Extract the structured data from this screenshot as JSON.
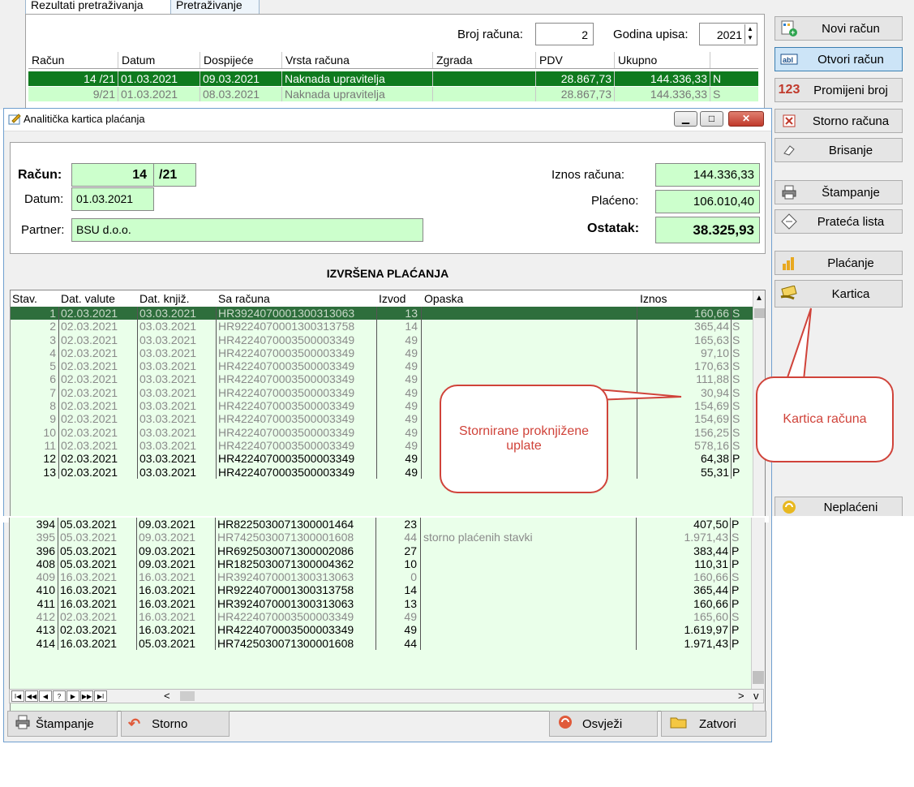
{
  "bg": {
    "tabs": [
      "Rezultati pretraživanja",
      "Pretraživanje"
    ],
    "broj_racuna_label": "Broj računa:",
    "broj_racuna_value": "2",
    "godina_label": "Godina upisa:",
    "godina_value": "2021",
    "columns": [
      "Račun",
      "Datum",
      "Dospijeće",
      "Vrsta računa",
      "Zgrada",
      "PDV",
      "Ukupno"
    ],
    "rows": [
      {
        "racun": "14 /21",
        "datum": "01.03.2021",
        "dospijece": "09.03.2021",
        "vrsta": "Naknada upravitelja",
        "zgrada": "",
        "pdv": "28.867,73",
        "ukupno": "144.336,33",
        "s": "N"
      },
      {
        "racun": "9/21",
        "datum": "01.03.2021",
        "dospijece": "08.03.2021",
        "vrsta": "Naknada upravitelja",
        "zgrada": "",
        "pdv": "28.867,73",
        "ukupno": "144.336,33",
        "s": "S"
      }
    ]
  },
  "toolbar": {
    "novi": "Novi račun",
    "otvori": "Otvori račun",
    "promijeni": "Promijeni broj",
    "storno": "Storno računa",
    "brisanje": "Brisanje",
    "stampanje": "Štampanje",
    "prateca": "Prateća lista",
    "placanje": "Plaćanje",
    "kartica": "Kartica",
    "neplaceni": "Neplaćeni",
    "icon_123": "123"
  },
  "dialog": {
    "title": "Analitička kartica plaćanja",
    "racun_label": "Račun:",
    "racun_num": "14",
    "racun_year": "/21",
    "datum_label": "Datum:",
    "datum_value": "01.03.2021",
    "partner_label": "Partner:",
    "partner_value": "BSU d.o.o.",
    "iznos_label": "Iznos računa:",
    "iznos_value": "144.336,33",
    "placeno_label": "Plaćeno:",
    "placeno_value": "106.010,40",
    "ostatak_label": "Ostatak:",
    "ostatak_value": "38.325,93",
    "section_title": "IZVRŠENA PLAĆANJA",
    "columns": [
      "Stav.",
      "Dat. valute",
      "Dat. knjiž.",
      "Sa računa",
      "Izvod",
      "Opaska",
      "Iznos"
    ],
    "btn_stampanje": "Štampanje",
    "btn_storno": "Storno",
    "btn_osvjezi": "Osvježi",
    "btn_zatvori": "Zatvori",
    "nav": [
      "I◀",
      "◀◀",
      "◀",
      "?",
      "▶",
      "▶▶",
      "▶I"
    ]
  },
  "payments_top": [
    {
      "stav": "1",
      "valuta": "02.03.2021",
      "knjiz": "03.03.2021",
      "racun": "HR3924070001300313063",
      "izvod": "13",
      "opaska": "",
      "iznos": "160,66",
      "s": "S",
      "kind": "sel"
    },
    {
      "stav": "2",
      "valuta": "02.03.2021",
      "knjiz": "03.03.2021",
      "racun": "HR9224070001300313758",
      "izvod": "14",
      "opaska": "",
      "iznos": "365,44",
      "s": "S",
      "kind": "storno"
    },
    {
      "stav": "3",
      "valuta": "02.03.2021",
      "knjiz": "03.03.2021",
      "racun": "HR4224070003500003349",
      "izvod": "49",
      "opaska": "",
      "iznos": "165,63",
      "s": "S",
      "kind": "storno"
    },
    {
      "stav": "4",
      "valuta": "02.03.2021",
      "knjiz": "03.03.2021",
      "racun": "HR4224070003500003349",
      "izvod": "49",
      "opaska": "",
      "iznos": "97,10",
      "s": "S",
      "kind": "storno"
    },
    {
      "stav": "5",
      "valuta": "02.03.2021",
      "knjiz": "03.03.2021",
      "racun": "HR4224070003500003349",
      "izvod": "49",
      "opaska": "",
      "iznos": "170,63",
      "s": "S",
      "kind": "storno"
    },
    {
      "stav": "6",
      "valuta": "02.03.2021",
      "knjiz": "03.03.2021",
      "racun": "HR4224070003500003349",
      "izvod": "49",
      "opaska": "",
      "iznos": "111,88",
      "s": "S",
      "kind": "storno"
    },
    {
      "stav": "7",
      "valuta": "02.03.2021",
      "knjiz": "03.03.2021",
      "racun": "HR4224070003500003349",
      "izvod": "49",
      "opaska": "",
      "iznos": "30,94",
      "s": "S",
      "kind": "storno"
    },
    {
      "stav": "8",
      "valuta": "02.03.2021",
      "knjiz": "03.03.2021",
      "racun": "HR4224070003500003349",
      "izvod": "49",
      "opaska": "",
      "iznos": "154,69",
      "s": "S",
      "kind": "storno"
    },
    {
      "stav": "9",
      "valuta": "02.03.2021",
      "knjiz": "03.03.2021",
      "racun": "HR4224070003500003349",
      "izvod": "49",
      "opaska": "",
      "iznos": "154,69",
      "s": "S",
      "kind": "storno"
    },
    {
      "stav": "10",
      "valuta": "02.03.2021",
      "knjiz": "03.03.2021",
      "racun": "HR4224070003500003349",
      "izvod": "49",
      "opaska": "",
      "iznos": "156,25",
      "s": "S",
      "kind": "storno"
    },
    {
      "stav": "11",
      "valuta": "02.03.2021",
      "knjiz": "03.03.2021",
      "racun": "HR4224070003500003349",
      "izvod": "49",
      "opaska": "",
      "iznos": "578,16",
      "s": "S",
      "kind": "storno"
    },
    {
      "stav": "12",
      "valuta": "02.03.2021",
      "knjiz": "03.03.2021",
      "racun": "HR4224070003500003349",
      "izvod": "49",
      "opaska": "",
      "iznos": "64,38",
      "s": "P",
      "kind": "posted"
    },
    {
      "stav": "13",
      "valuta": "02.03.2021",
      "knjiz": "03.03.2021",
      "racun": "HR4224070003500003349",
      "izvod": "49",
      "opaska": "",
      "iznos": "55,31",
      "s": "P",
      "kind": "posted"
    }
  ],
  "payments_bottom": [
    {
      "stav": "394",
      "valuta": "05.03.2021",
      "knjiz": "09.03.2021",
      "racun": "HR8225030071300001464",
      "izvod": "23",
      "opaska": "",
      "iznos": "407,50",
      "s": "P",
      "kind": "posted"
    },
    {
      "stav": "395",
      "valuta": "05.03.2021",
      "knjiz": "09.03.2021",
      "racun": "HR7425030071300001608",
      "izvod": "44",
      "opaska": "storno plaćenih stavki",
      "iznos": "1.971,43",
      "s": "S",
      "kind": "storno"
    },
    {
      "stav": "396",
      "valuta": "05.03.2021",
      "knjiz": "09.03.2021",
      "racun": "HR6925030071300002086",
      "izvod": "27",
      "opaska": "",
      "iznos": "383,44",
      "s": "P",
      "kind": "posted"
    },
    {
      "stav": "408",
      "valuta": "05.03.2021",
      "knjiz": "09.03.2021",
      "racun": "HR1825030071300004362",
      "izvod": "10",
      "opaska": "",
      "iznos": "110,31",
      "s": "P",
      "kind": "posted"
    },
    {
      "stav": "409",
      "valuta": "16.03.2021",
      "knjiz": "16.03.2021",
      "racun": "HR3924070001300313063",
      "izvod": "0",
      "opaska": "",
      "iznos": "160,66",
      "s": "S",
      "kind": "storno"
    },
    {
      "stav": "410",
      "valuta": "16.03.2021",
      "knjiz": "16.03.2021",
      "racun": "HR9224070001300313758",
      "izvod": "14",
      "opaska": "",
      "iznos": "365,44",
      "s": "P",
      "kind": "posted"
    },
    {
      "stav": "411",
      "valuta": "16.03.2021",
      "knjiz": "16.03.2021",
      "racun": "HR3924070001300313063",
      "izvod": "13",
      "opaska": "",
      "iznos": "160,66",
      "s": "P",
      "kind": "posted"
    },
    {
      "stav": "412",
      "valuta": "02.03.2021",
      "knjiz": "16.03.2021",
      "racun": "HR4224070003500003349",
      "izvod": "49",
      "opaska": "",
      "iznos": "165,60",
      "s": "S",
      "kind": "storno"
    },
    {
      "stav": "413",
      "valuta": "02.03.2021",
      "knjiz": "16.03.2021",
      "racun": "HR4224070003500003349",
      "izvod": "49",
      "opaska": "",
      "iznos": "1.619,97",
      "s": "P",
      "kind": "posted"
    },
    {
      "stav": "414",
      "valuta": "16.03.2021",
      "knjiz": "05.03.2021",
      "racun": "HR7425030071300001608",
      "izvod": "44",
      "opaska": "",
      "iznos": "1.971,43",
      "s": "P",
      "kind": "posted"
    }
  ],
  "callouts": {
    "storno": "Stornirane proknjižene uplate",
    "kartica": "Kartica računa"
  },
  "colors": {
    "accent_green": "#ccffcc",
    "selected_row": "#0f7a1e",
    "callout_red": "#d0433a"
  }
}
